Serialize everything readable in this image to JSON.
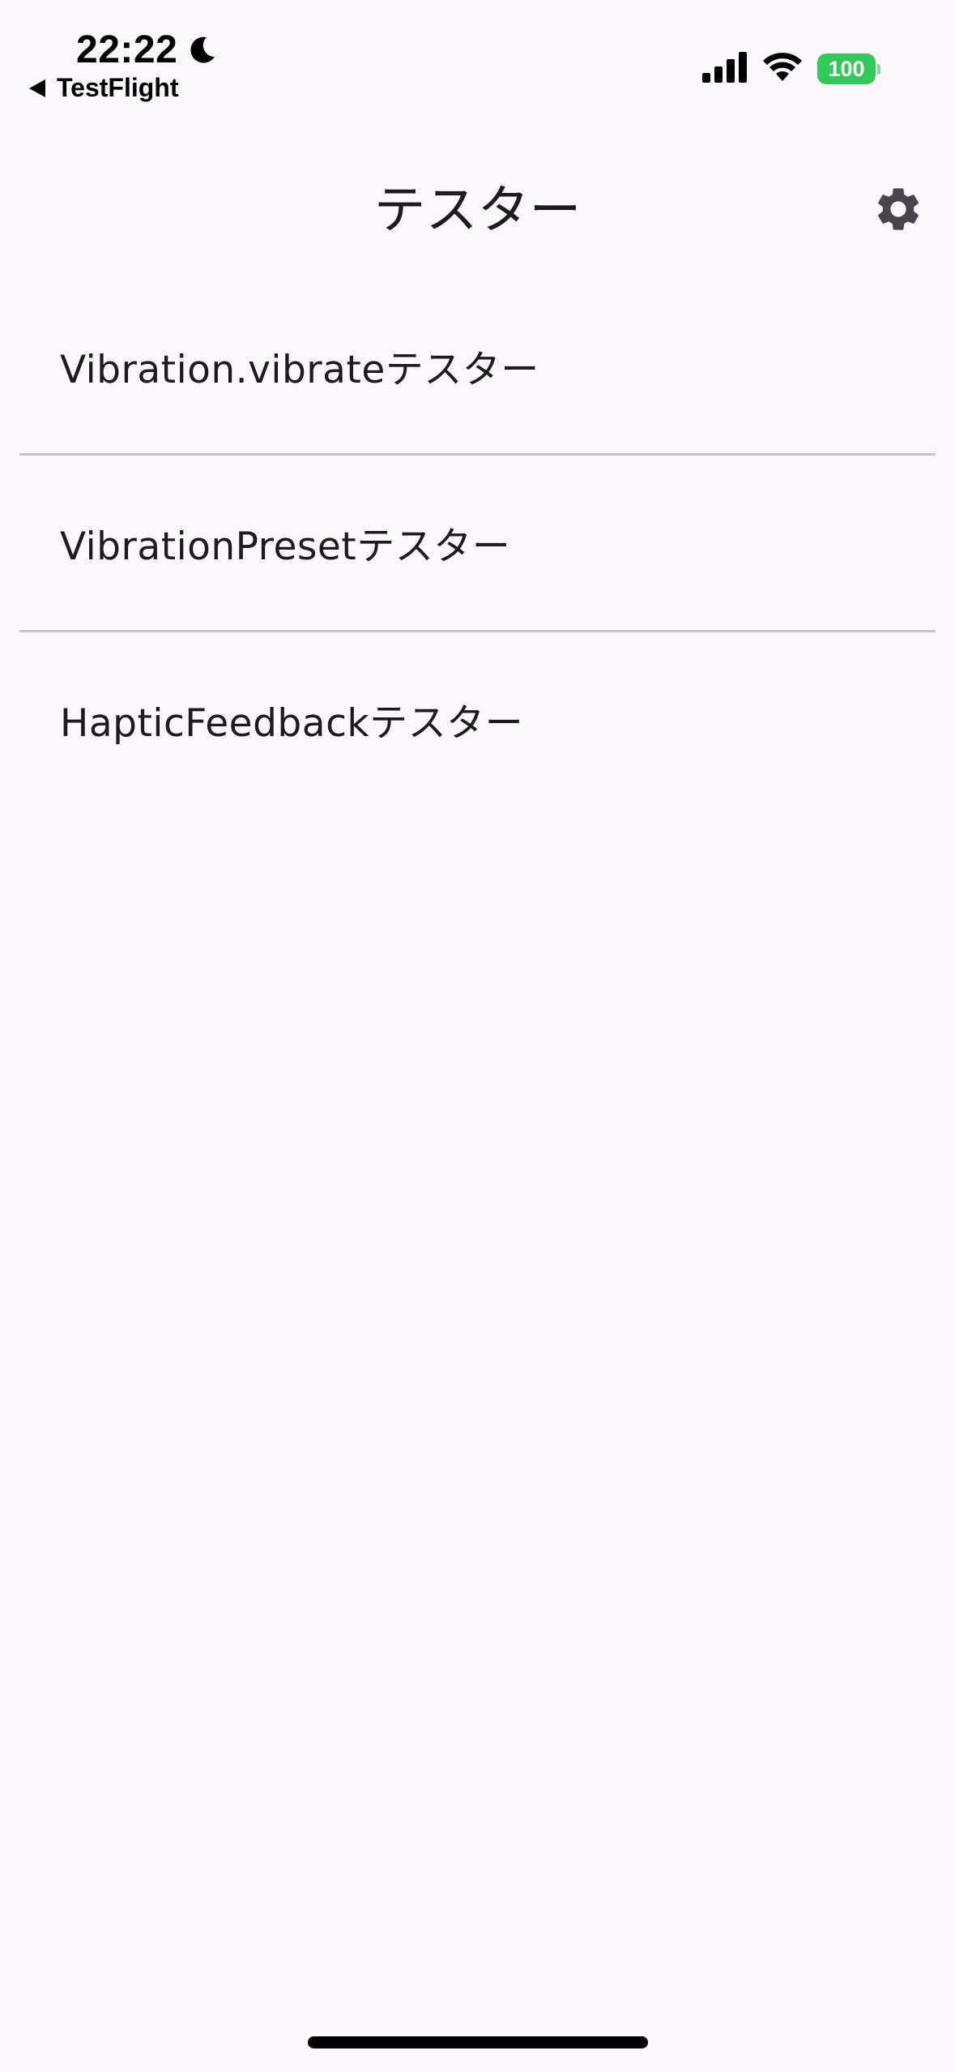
{
  "status_bar": {
    "time": "22:22",
    "back_app": "TestFlight",
    "battery_level": "100",
    "battery_color": "#34c759"
  },
  "app_bar": {
    "title": "テスター",
    "settings_icon": "gear-icon"
  },
  "menu": {
    "items": [
      {
        "label": "Vibration.vibrateテスター"
      },
      {
        "label": "VibrationPresetテスター"
      },
      {
        "label": "HapticFeedbackテスター"
      }
    ]
  }
}
